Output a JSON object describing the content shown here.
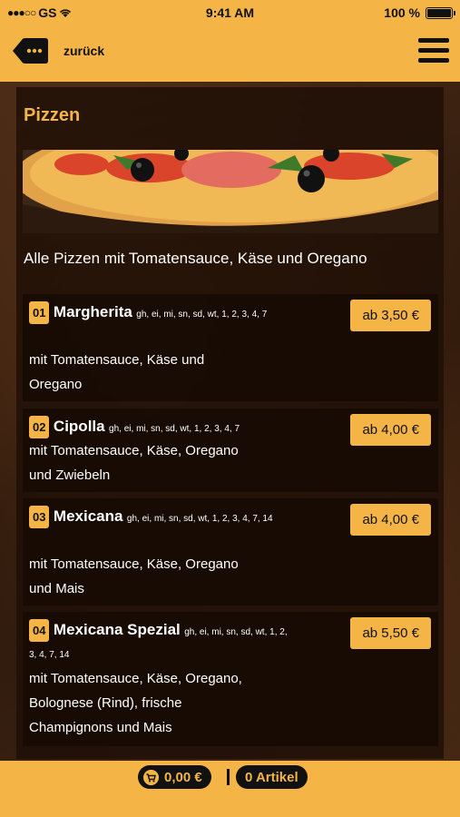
{
  "status_bar": {
    "carrier": "GS",
    "time": "9:41 AM",
    "battery": "100 %"
  },
  "header": {
    "back_label": "zurück"
  },
  "section": {
    "title": "Pizzen",
    "intro": "Alle Pizzen mit Tomatensauce, Käse und Oregano"
  },
  "items": [
    {
      "number": "01",
      "name": "Margherita",
      "allergens": "gh, ei, mi, sn, sd, wt, 1, 2, 3, 4, 7",
      "price": "ab 3,50 €",
      "desc_lines": [
        "mit Tomatensauce, Käse und",
        "Oregano"
      ]
    },
    {
      "number": "02",
      "name": "Cipolla",
      "allergens": "gh, ei, mi, sn, sd, wt, 1, 2, 3, 4, 7",
      "price": "ab 4,00 €",
      "desc_lines": [
        "mit Tomatensauce, Käse, Oregano",
        "und Zwiebeln"
      ]
    },
    {
      "number": "03",
      "name": "Mexicana",
      "allergens": "gh, ei, mi, sn, sd, wt, 1, 2, 3, 4, 7, 14",
      "price": "ab 4,00 €",
      "desc_lines": [
        "mit Tomatensauce, Käse, Oregano",
        "und Mais"
      ]
    },
    {
      "number": "04",
      "name": "Mexicana Spezial",
      "allergens": "gh, ei, mi, sn, sd, wt, 1, 2, 3, 4, 7, 14",
      "price": "ab 5,50 €",
      "desc_lines": [
        "mit Tomatensauce, Käse, Oregano,",
        "Bolognese (Rind), frische",
        "Champignons und Mais"
      ]
    }
  ],
  "footer": {
    "cart_total": "0,00 €",
    "article_count": "0 Artikel"
  },
  "colors": {
    "accent": "#f5b446",
    "dark": "#111111"
  }
}
